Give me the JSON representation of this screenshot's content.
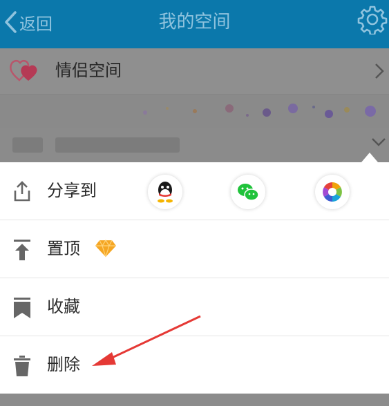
{
  "navbar": {
    "back_label": "返回",
    "title": "我的空间"
  },
  "couple_space": {
    "label": "情侣空间"
  },
  "menu": {
    "share_label": "分享到",
    "pin_label": "置顶",
    "favorite_label": "收藏",
    "delete_label": "删除"
  },
  "colors": {
    "navbar": "#0b78ab",
    "overlay": "#8c8c8c",
    "sheet": "#ffffff",
    "annotation_arrow": "#e53935",
    "wechat_green": "#20c33b"
  },
  "icons": [
    "back-chevron-icon",
    "gear-icon",
    "heart-icon",
    "chevron-right-icon",
    "chevron-down-icon",
    "share-icon",
    "qq-icon",
    "wechat-icon",
    "moments-icon",
    "pin-top-icon",
    "diamond-icon",
    "bookmark-icon",
    "trash-icon"
  ]
}
